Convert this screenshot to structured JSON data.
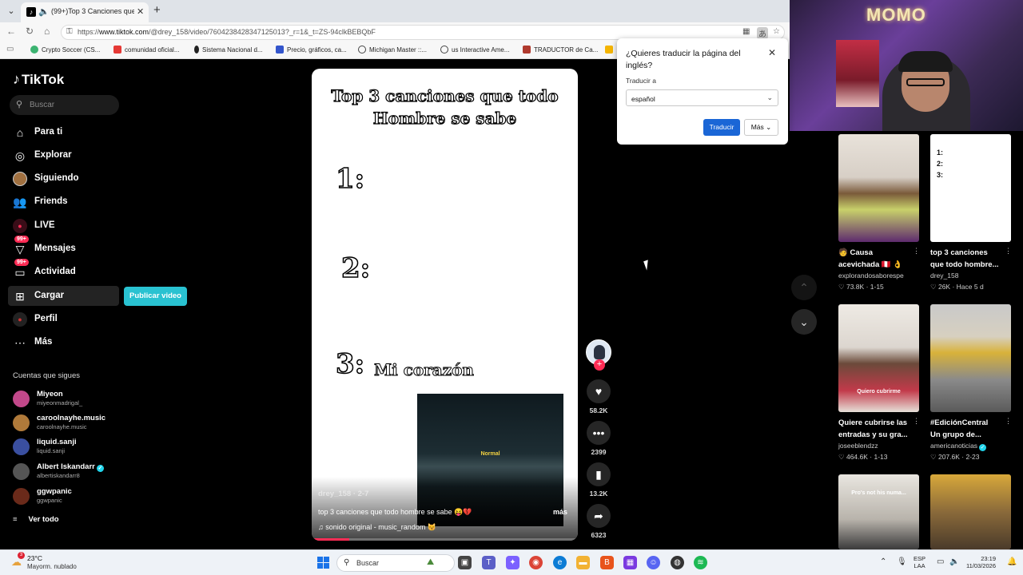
{
  "browser": {
    "tab_title": "(99+)Top 3 Canciones que To",
    "url_prefix": "https://",
    "url_host": "www.tiktok.com",
    "url_path": "/@drey_158/video/7604238428347125013?_r=1&_t=ZS-94clkBEBQbF",
    "bookmarks": [
      "Crypto Soccer (CS...",
      "comunidad oficial...",
      "Sistema Nacional d...",
      "Precio, gráficos, ca...",
      "Michigan Master ::...",
      "us Interactive Ame...",
      "TRADUCTOR de Ca..."
    ]
  },
  "sidebar": {
    "logo": "TikTok",
    "search_placeholder": "Buscar",
    "nav": [
      {
        "label": "Para ti",
        "icon": "home-icon"
      },
      {
        "label": "Explorar",
        "icon": "compass-icon"
      },
      {
        "label": "Siguiendo",
        "icon": "following-avatar-icon"
      },
      {
        "label": "Friends",
        "icon": "friends-icon"
      },
      {
        "label": "LIVE",
        "icon": "live-icon"
      },
      {
        "label": "Mensajes",
        "icon": "messages-icon",
        "badge": "99+"
      },
      {
        "label": "Actividad",
        "icon": "activity-icon",
        "badge": "99+"
      },
      {
        "label": "Cargar",
        "icon": "upload-icon"
      },
      {
        "label": "Perfil",
        "icon": "profile-icon"
      },
      {
        "label": "Más",
        "icon": "more-icon"
      }
    ],
    "publish_button": "Publicar video",
    "following_title": "Cuentas que sigues",
    "accounts": [
      {
        "name": "Miyeon",
        "handle": "miyeonmadrigal_",
        "verified": false,
        "color": "#c2488a"
      },
      {
        "name": "caroolnayhe.music",
        "handle": "caroolnayhe.music",
        "verified": false,
        "color": "#b07a3a"
      },
      {
        "name": "liquid.sanji",
        "handle": "liquid.sanji",
        "verified": false,
        "color": "#3a4fa0"
      },
      {
        "name": "Albert Iskandarr",
        "handle": "albertiskandarr8",
        "verified": true,
        "color": "#555555"
      },
      {
        "name": "ggwpanic",
        "handle": "ggwpanic",
        "verified": false,
        "color": "#6a2a1a"
      }
    ],
    "see_all": "Ver todo"
  },
  "video": {
    "title_line1": "Top 3 canciones  que todo",
    "title_line2": "Hombre se sabe",
    "rank1": "1:",
    "rank2": "2:",
    "rank3": "3:",
    "song3": "Mi corazón",
    "inset_caption": "Normal",
    "author": "drey_158 · 2-7",
    "description": "top 3 canciones que todo hombre se sabe 😝💔",
    "more": "más",
    "music": "sonido original - music_random 😽",
    "progress": 0.14
  },
  "actions": {
    "likes": "58.2K",
    "comments": "2399",
    "saves": "13.2K",
    "shares": "6323"
  },
  "translate_popup": {
    "question": "¿Quieres traducir la página del inglés?",
    "label": "Traducir a",
    "selected_language": "español",
    "translate_button": "Traducir",
    "more_button": "Más"
  },
  "webcam": {
    "neon_sign": "MOMO"
  },
  "recommendations": [
    {
      "title1": "🧑 Causa",
      "title2": "acevichada 🇵🇪 👌",
      "author": "explorandosaborespe",
      "views": "♡ 73.8K",
      "date": "1-15",
      "verified": false
    },
    {
      "title1": "top 3 canciones",
      "title2": "que todo hombre...",
      "author": "drey_158",
      "views": "♡ 26K",
      "date": "Hace 5 d",
      "verified": false
    },
    {
      "title1": "Quiere cubrirse las",
      "title2": "entradas y su gra...",
      "author": "joseeblendzz",
      "views": "♡ 464.6K",
      "date": "1-13",
      "verified": false,
      "caption": "Quiero cubrirme"
    },
    {
      "title1": "#EdiciónCentral",
      "title2": "Un grupo de...",
      "author": "americanoticias",
      "views": "♡ 207.6K",
      "date": "2-23",
      "verified": true
    },
    {
      "caption": "Pro's not his numa..."
    },
    {
      "caption": ""
    }
  ],
  "rec_thumb2": {
    "l1": "1:",
    "l2": "2:",
    "l3": "3:"
  },
  "taskbar": {
    "weather_badge": "3",
    "temperature": "23°C",
    "condition": "Mayorm. nublado",
    "search_placeholder": "Buscar",
    "lang_line1": "ESP",
    "lang_line2": "LAA",
    "time": "23:19",
    "date": "11/03/2026"
  },
  "colors": {
    "accent_pink": "#fe2c55",
    "publish_cyan": "#29c2d1",
    "translate_blue": "#1a66d6"
  }
}
